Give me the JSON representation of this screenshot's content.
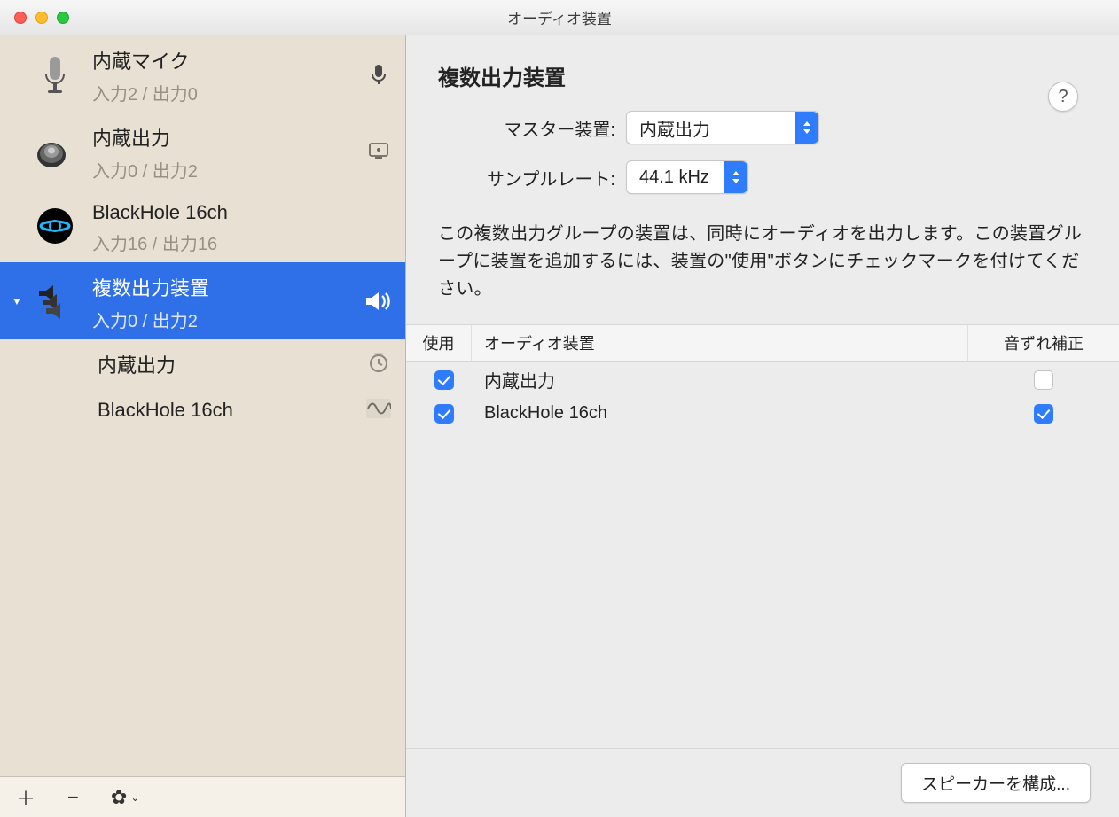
{
  "window": {
    "title": "オーディオ装置"
  },
  "sidebar": {
    "devices": [
      {
        "name": "内蔵マイク",
        "io": "入力2 / 出力0",
        "right_icon": "mic",
        "icon": "mic"
      },
      {
        "name": "内蔵出力",
        "io": "入力0 / 出力2",
        "right_icon": "display",
        "icon": "speaker"
      },
      {
        "name": "BlackHole 16ch",
        "io": "入力16 / 出力16",
        "right_icon": "",
        "icon": "blackhole"
      },
      {
        "name": "複数出力装置",
        "io": "入力0 / 出力2",
        "right_icon": "volume",
        "icon": "multi",
        "selected": true,
        "children": [
          {
            "name": "内蔵出力",
            "right_icon": "clock"
          },
          {
            "name": "BlackHole 16ch",
            "right_icon": "wave"
          }
        ]
      }
    ]
  },
  "detail": {
    "title": "複数出力装置",
    "master_label": "マスター装置:",
    "master_value": "内蔵出力",
    "rate_label": "サンプルレート:",
    "rate_value": "44.1 kHz",
    "description": "この複数出力グループの装置は、同時にオーディオを出力します。この装置グループに装置を追加するには、装置の\"使用\"ボタンにチェックマークを付けてください。",
    "columns": {
      "use": "使用",
      "name": "オーディオ装置",
      "drift": "音ずれ補正"
    },
    "rows": [
      {
        "name": "内蔵出力",
        "use": true,
        "drift": false
      },
      {
        "name": "BlackHole 16ch",
        "use": true,
        "drift": true
      }
    ],
    "configure_button": "スピーカーを構成..."
  }
}
